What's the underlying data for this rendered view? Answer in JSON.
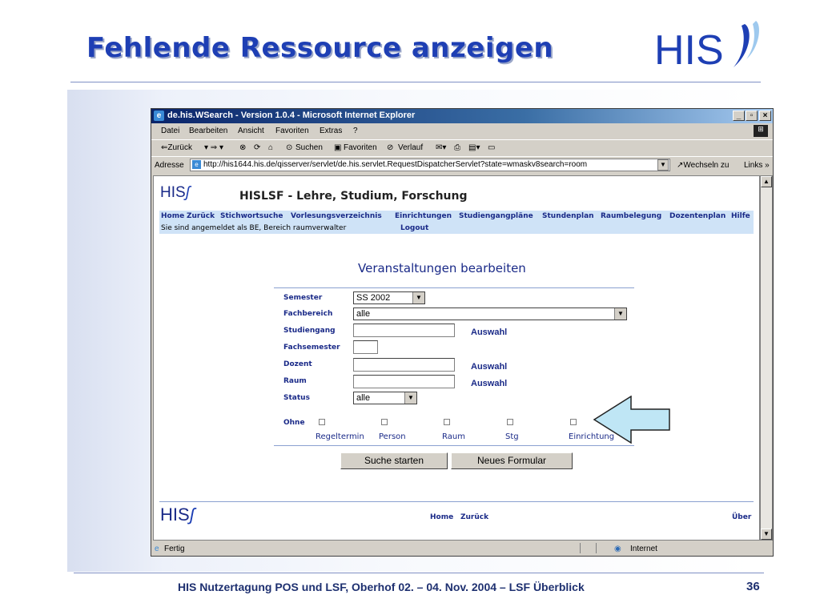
{
  "slide": {
    "title": "Fehlende Ressource anzeigen",
    "logo_text": "HIS",
    "footer": "HIS Nutzertagung POS und LSF, Oberhof 02. – 04. Nov. 2004 – LSF Überblick",
    "page_number": "36"
  },
  "browser": {
    "window_title": "de.his.WSearch - Version 1.0.4 - Microsoft Internet Explorer",
    "menu": [
      "Datei",
      "Bearbeiten",
      "Ansicht",
      "Favoriten",
      "Extras",
      "?"
    ],
    "toolbar": {
      "back": "⇐Zurück",
      "search": "Suchen",
      "favorites": "Favoriten",
      "history": "Verlauf"
    },
    "address_label": "Adresse",
    "url": "http://his1644.his.de/qisserver/servlet/de.his.servlet.RequestDispatcherServlet?state=wmaskv8search=room",
    "go_label": "Wechseln zu",
    "links_label": "Links",
    "status_left": "Fertig",
    "status_zone": "Internet"
  },
  "page": {
    "logo": "HIS",
    "header": "HISLSF - Lehre, Studium, Forschung",
    "nav": [
      "Home",
      "Zurück",
      "Stichwortsuche",
      "Vorlesungsverzeichnis",
      "Einrichtungen",
      "Studiengangpläne",
      "Stundenplan",
      "Raumbelegung",
      "Dozentenplan",
      "Hilfe"
    ],
    "login_text": "Sie sind angemeldet als  BE, Bereich raumverwalter",
    "logout": "Logout",
    "form_title": "Veranstaltungen bearbeiten",
    "fields": {
      "semester": {
        "label": "Semester",
        "value": "SS 2002"
      },
      "fachbereich": {
        "label": "Fachbereich",
        "value": "alle"
      },
      "studiengang": {
        "label": "Studiengang",
        "link": "Auswahl"
      },
      "fachsemester": {
        "label": "Fachsemester"
      },
      "dozent": {
        "label": "Dozent",
        "link": "Auswahl"
      },
      "raum": {
        "label": "Raum",
        "link": "Auswahl"
      },
      "status": {
        "label": "Status",
        "value": "alle"
      }
    },
    "ohne_label": "Ohne",
    "checkboxes": [
      "Regeltermin",
      "Person",
      "Raum",
      "Stg",
      "Einrichtung"
    ],
    "buttons": {
      "search": "Suche starten",
      "reset": "Neues Formular"
    },
    "footer_nav": {
      "home": "Home",
      "back": "Zurück",
      "about": "Über"
    }
  }
}
